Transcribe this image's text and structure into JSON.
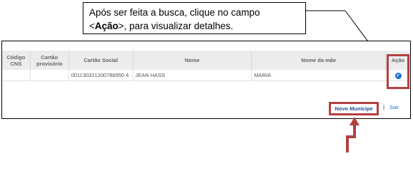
{
  "callout": {
    "line1": "Após ser feita a busca, clique no campo",
    "open": "<",
    "bold": "Ação",
    "close": ">, para visualizar detalhes."
  },
  "table": {
    "headers": {
      "codigo_cns": "Código CNS",
      "cartao_provisorio": "Cartão provisório",
      "cartao_social": "Cartão Social",
      "nome": "Nome",
      "nome_mae": "Nome da mãe",
      "acao": "Ação"
    },
    "row": {
      "codigo_cns": "",
      "cartao_provisorio": "",
      "cartao_social": "001130321200786950 4",
      "nome": "JEAN HASS",
      "nome_mae": "MARIA"
    }
  },
  "actions": {
    "novo_municipe": "Novo Munícipe",
    "separator": "|",
    "sair": "Sair"
  },
  "colors": {
    "highlight": "#b34040",
    "link": "#1f4f93",
    "check": "#1e6fd0"
  },
  "icons": {
    "acao": "check-circle-icon",
    "arrow": "arrow-up-icon"
  }
}
